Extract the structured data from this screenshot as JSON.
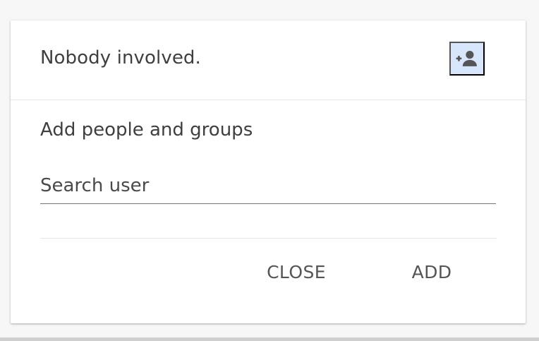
{
  "header": {
    "text": "Nobody involved.",
    "add_person_icon": "person-add-icon"
  },
  "form": {
    "section_title": "Add people and groups",
    "search_placeholder": "Search user",
    "search_value": ""
  },
  "actions": {
    "close_label": "CLOSE",
    "add_label": "ADD"
  },
  "colors": {
    "card_background": "#ffffff",
    "page_background": "#f7f7f7",
    "icon_highlight": "#d8e6fb",
    "text": "#3f3f3f",
    "muted_text": "#555555"
  }
}
